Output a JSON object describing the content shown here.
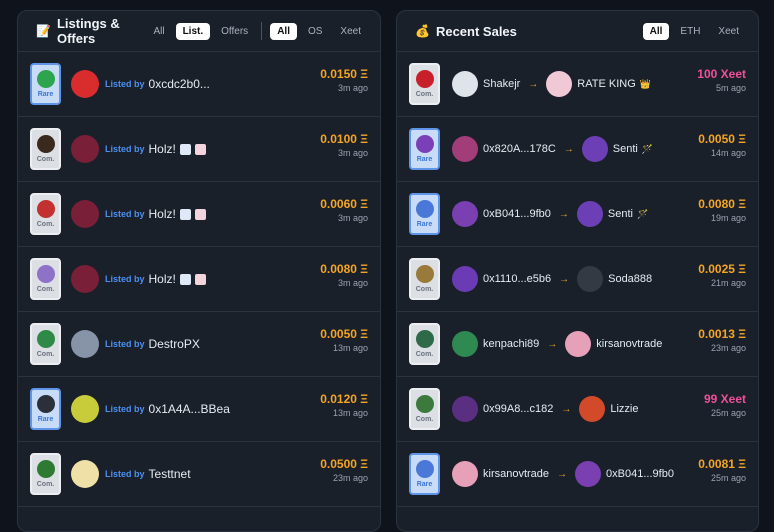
{
  "listings": {
    "icon": "notepad-icon",
    "title": "Listings & Offers",
    "tabs_a": [
      "All",
      "List.",
      "Offers"
    ],
    "tabs_b": [
      "All",
      "OS",
      "Xeet"
    ],
    "rows": [
      {
        "badge": "Rare",
        "listed": "Listed by",
        "name": "0xcdc2b0...",
        "price": "0.0150 Ξ",
        "time": "3m ago",
        "thumb_color": "#2ea44f",
        "avatar_color": "#d92c2c",
        "emotes": false
      },
      {
        "badge": "Com.",
        "listed": "Listed by",
        "name": "Holz!",
        "price": "0.0100 Ξ",
        "time": "3m ago",
        "thumb_color": "#3a2a1e",
        "avatar_color": "#7a1f38",
        "emotes": true
      },
      {
        "badge": "Com.",
        "listed": "Listed by",
        "name": "Holz!",
        "price": "0.0060 Ξ",
        "time": "3m ago",
        "thumb_color": "#c23030",
        "avatar_color": "#7a1f38",
        "emotes": true
      },
      {
        "badge": "Com.",
        "listed": "Listed by",
        "name": "Holz!",
        "price": "0.0080 Ξ",
        "time": "3m ago",
        "thumb_color": "#8e72c8",
        "avatar_color": "#7a1f38",
        "emotes": true
      },
      {
        "badge": "Com.",
        "listed": "Listed by",
        "name": "DestroPX",
        "price": "0.0050 Ξ",
        "time": "13m ago",
        "thumb_color": "#2e8a46",
        "avatar_color": "#8794a8",
        "emotes": false
      },
      {
        "badge": "Rare",
        "listed": "Listed by",
        "name": "0x1A4A...BBea",
        "price": "0.0120 Ξ",
        "time": "13m ago",
        "thumb_color": "#2a2f3a",
        "avatar_color": "#c9cc3a",
        "emotes": false
      },
      {
        "badge": "Com.",
        "listed": "Listed by",
        "name": "Testtnet",
        "price": "0.0500 Ξ",
        "time": "23m ago",
        "thumb_color": "#2e7a33",
        "avatar_color": "#efe0a8",
        "emotes": false
      }
    ]
  },
  "sales": {
    "icon": "money-bag-icon",
    "title": "Recent Sales",
    "tabs": [
      "All",
      "ETH",
      "Xeet"
    ],
    "rows": [
      {
        "badge": "Com.",
        "seller": "Shakejr",
        "buyer": "RATE KING",
        "buyer_deco": "👑",
        "price": "100 Xeet",
        "xeet": true,
        "time": "5m ago",
        "thumb_color": "#c8202a",
        "seller_color": "#dfe3ea",
        "buyer_color": "#f1c9d6"
      },
      {
        "badge": "Rare",
        "seller": "0x820A...178C",
        "buyer": "Senti",
        "buyer_deco": "🪄",
        "price": "0.0050 Ξ",
        "xeet": false,
        "time": "14m ago",
        "thumb_color": "#7b3fb8",
        "seller_color": "#a33d7a",
        "buyer_color": "#6d3fb6"
      },
      {
        "badge": "Rare",
        "seller": "0xB041...9fb0",
        "buyer": "Senti",
        "buyer_deco": "🪄",
        "price": "0.0080 Ξ",
        "xeet": false,
        "time": "19m ago",
        "thumb_color": "#4a78d8",
        "seller_color": "#7a3fb0",
        "buyer_color": "#6d3fb6"
      },
      {
        "badge": "Com.",
        "seller": "0x1110...e5b6",
        "buyer": "Soda888",
        "buyer_deco": "",
        "price": "0.0025 Ξ",
        "xeet": false,
        "time": "21m ago",
        "thumb_color": "#9a7a3a",
        "seller_color": "#6b3bb5",
        "buyer_color": "#333a44"
      },
      {
        "badge": "Com.",
        "seller": "kenpachi89",
        "buyer": "kirsanovtrade",
        "buyer_deco": "",
        "price": "0.0013 Ξ",
        "xeet": false,
        "time": "23m ago",
        "thumb_color": "#2f6a48",
        "seller_color": "#2f8a52",
        "buyer_color": "#e6a1b8"
      },
      {
        "badge": "Com.",
        "seller": "0x99A8...c182",
        "buyer": "Lizzie",
        "buyer_deco": "",
        "price": "99 Xeet",
        "xeet": true,
        "time": "25m ago",
        "thumb_color": "#3b7a3c",
        "seller_color": "#5a2f82",
        "buyer_color": "#d34a2a"
      },
      {
        "badge": "Rare",
        "seller": "kirsanovtrade",
        "buyer": "0xB041...9fb0",
        "buyer_deco": "",
        "price": "0.0081 Ξ",
        "xeet": false,
        "time": "25m ago",
        "thumb_color": "#4a78d8",
        "seller_color": "#e6a1b8",
        "buyer_color": "#7a3fb0"
      }
    ]
  }
}
